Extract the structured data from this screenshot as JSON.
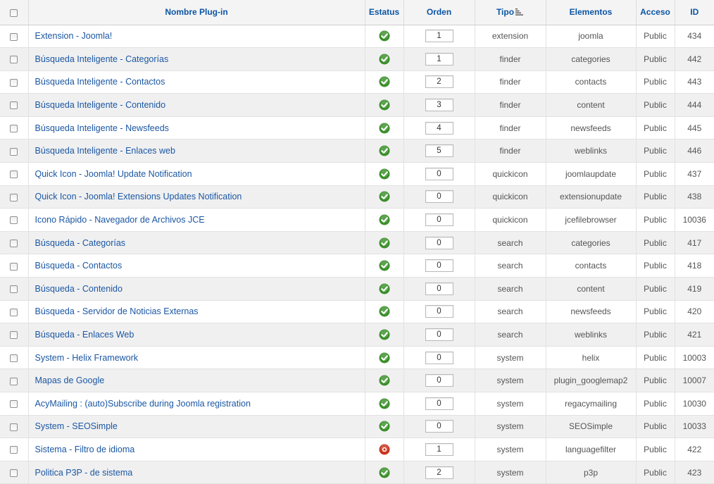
{
  "columns": {
    "name": "Nombre Plug-in",
    "status": "Estatus",
    "order": "Orden",
    "type": "Tipo",
    "elements": "Elementos",
    "access": "Acceso",
    "id": "ID"
  },
  "colors": {
    "link": "#1b57a3",
    "header_link": "#0b55a4",
    "enabled": "#3b8f2a",
    "disabled": "#c8321c",
    "row_alt": "#f0f0f0"
  },
  "rows": [
    {
      "name": "Extension - Joomla!",
      "status": "enabled",
      "order": "1",
      "type": "extension",
      "element": "joomla",
      "access": "Public",
      "id": "434"
    },
    {
      "name": "Búsqueda Inteligente - Categorías",
      "status": "enabled",
      "order": "1",
      "type": "finder",
      "element": "categories",
      "access": "Public",
      "id": "442"
    },
    {
      "name": "Búsqueda Inteligente - Contactos",
      "status": "enabled",
      "order": "2",
      "type": "finder",
      "element": "contacts",
      "access": "Public",
      "id": "443"
    },
    {
      "name": "Búsqueda Inteligente - Contenido",
      "status": "enabled",
      "order": "3",
      "type": "finder",
      "element": "content",
      "access": "Public",
      "id": "444"
    },
    {
      "name": "Búsqueda Inteligente - Newsfeeds",
      "status": "enabled",
      "order": "4",
      "type": "finder",
      "element": "newsfeeds",
      "access": "Public",
      "id": "445"
    },
    {
      "name": "Búsqueda Inteligente - Enlaces web",
      "status": "enabled",
      "order": "5",
      "type": "finder",
      "element": "weblinks",
      "access": "Public",
      "id": "446"
    },
    {
      "name": "Quick Icon - Joomla! Update Notification",
      "status": "enabled",
      "order": "0",
      "type": "quickicon",
      "element": "joomlaupdate",
      "access": "Public",
      "id": "437"
    },
    {
      "name": "Quick Icon - Joomla! Extensions Updates Notification",
      "status": "enabled",
      "order": "0",
      "type": "quickicon",
      "element": "extensionupdate",
      "access": "Public",
      "id": "438"
    },
    {
      "name": "Icono Rápido - Navegador de Archivos JCE",
      "status": "enabled",
      "order": "0",
      "type": "quickicon",
      "element": "jcefilebrowser",
      "access": "Public",
      "id": "10036"
    },
    {
      "name": "Búsqueda - Categorías",
      "status": "enabled",
      "order": "0",
      "type": "search",
      "element": "categories",
      "access": "Public",
      "id": "417"
    },
    {
      "name": "Búsqueda - Contactos",
      "status": "enabled",
      "order": "0",
      "type": "search",
      "element": "contacts",
      "access": "Public",
      "id": "418"
    },
    {
      "name": "Búsqueda - Contenido",
      "status": "enabled",
      "order": "0",
      "type": "search",
      "element": "content",
      "access": "Public",
      "id": "419"
    },
    {
      "name": "Búsqueda - Servidor de Noticias Externas",
      "status": "enabled",
      "order": "0",
      "type": "search",
      "element": "newsfeeds",
      "access": "Public",
      "id": "420"
    },
    {
      "name": "Búsqueda - Enlaces Web",
      "status": "enabled",
      "order": "0",
      "type": "search",
      "element": "weblinks",
      "access": "Public",
      "id": "421"
    },
    {
      "name": "System - Helix Framework",
      "status": "enabled",
      "order": "0",
      "type": "system",
      "element": "helix",
      "access": "Public",
      "id": "10003"
    },
    {
      "name": "Mapas de Google",
      "status": "enabled",
      "order": "0",
      "type": "system",
      "element": "plugin_googlemap2",
      "access": "Public",
      "id": "10007"
    },
    {
      "name": "AcyMailing : (auto)Subscribe during Joomla registration",
      "status": "enabled",
      "order": "0",
      "type": "system",
      "element": "regacymailing",
      "access": "Public",
      "id": "10030"
    },
    {
      "name": "System - SEOSimple",
      "status": "enabled",
      "order": "0",
      "type": "system",
      "element": "SEOSimple",
      "access": "Public",
      "id": "10033"
    },
    {
      "name": "Sistema - Filtro de idioma",
      "status": "disabled",
      "order": "1",
      "type": "system",
      "element": "languagefilter",
      "access": "Public",
      "id": "422"
    },
    {
      "name": "Politica P3P - de sistema",
      "status": "enabled",
      "order": "2",
      "type": "system",
      "element": "p3p",
      "access": "Public",
      "id": "423"
    }
  ]
}
